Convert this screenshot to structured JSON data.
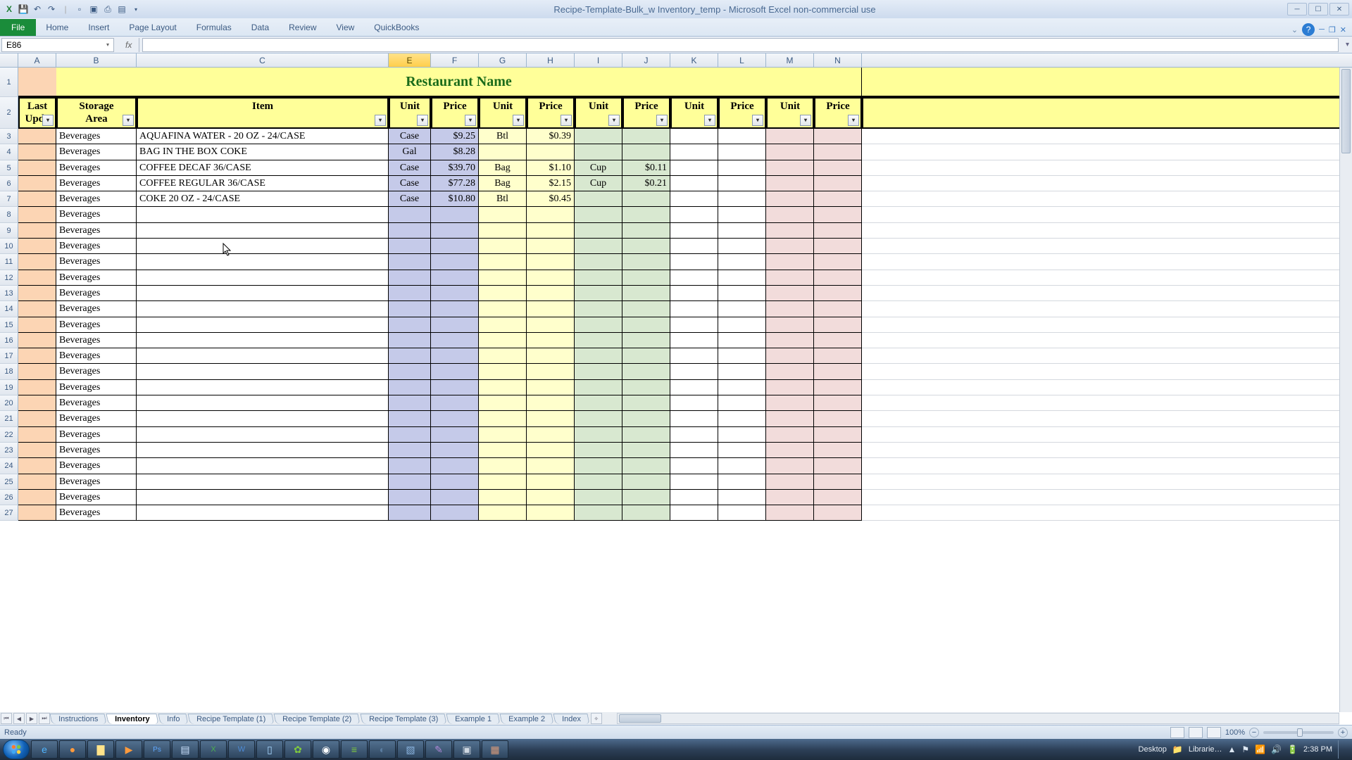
{
  "window": {
    "title": "Recipe-Template-Bulk_w Inventory_temp  -  Microsoft Excel non-commercial use"
  },
  "ribbon": {
    "file": "File",
    "tabs": [
      "Home",
      "Insert",
      "Page Layout",
      "Formulas",
      "Data",
      "Review",
      "View",
      "QuickBooks"
    ]
  },
  "formulabar": {
    "namebox": "E86",
    "formula": ""
  },
  "columns": [
    "A",
    "B",
    "C",
    "E",
    "F",
    "G",
    "H",
    "I",
    "J",
    "K",
    "L",
    "M",
    "N"
  ],
  "selected_column": "E",
  "title_cell": "Restaurant Name",
  "headers": {
    "A": "Last Update",
    "B": "Storage Area",
    "C": "Item",
    "E": "Unit",
    "F": "Price",
    "G": "Unit",
    "H": "Price",
    "I": "Unit",
    "J": "Price",
    "K": "Unit",
    "L": "Price",
    "M": "Unit",
    "N": "Price"
  },
  "rows": [
    {
      "n": 3,
      "B": "Beverages",
      "C": "AQUAFINA WATER - 20 OZ - 24/CASE",
      "E": "Case",
      "F": "$9.25",
      "G": "Btl",
      "H": "$0.39",
      "I": "",
      "J": "",
      "K": "",
      "L": "",
      "M": "",
      "N": ""
    },
    {
      "n": 4,
      "B": "Beverages",
      "C": "BAG IN THE BOX COKE",
      "E": "Gal",
      "F": "$8.28",
      "G": "",
      "H": "",
      "I": "",
      "J": "",
      "K": "",
      "L": "",
      "M": "",
      "N": ""
    },
    {
      "n": 5,
      "B": "Beverages",
      "C": "COFFEE DECAF 36/CASE",
      "E": "Case",
      "F": "$39.70",
      "G": "Bag",
      "H": "$1.10",
      "I": "Cup",
      "J": "$0.11",
      "K": "",
      "L": "",
      "M": "",
      "N": ""
    },
    {
      "n": 6,
      "B": "Beverages",
      "C": "COFFEE REGULAR 36/CASE",
      "E": "Case",
      "F": "$77.28",
      "G": "Bag",
      "H": "$2.15",
      "I": "Cup",
      "J": "$0.21",
      "K": "",
      "L": "",
      "M": "",
      "N": ""
    },
    {
      "n": 7,
      "B": "Beverages",
      "C": "COKE 20 OZ - 24/CASE",
      "E": "Case",
      "F": "$10.80",
      "G": "Btl",
      "H": "$0.45",
      "I": "",
      "J": "",
      "K": "",
      "L": "",
      "M": "",
      "N": ""
    },
    {
      "n": 8,
      "B": "Beverages"
    },
    {
      "n": 9,
      "B": "Beverages"
    },
    {
      "n": 10,
      "B": "Beverages"
    },
    {
      "n": 11,
      "B": "Beverages"
    },
    {
      "n": 12,
      "B": "Beverages"
    },
    {
      "n": 13,
      "B": "Beverages"
    },
    {
      "n": 14,
      "B": "Beverages"
    },
    {
      "n": 15,
      "B": "Beverages"
    },
    {
      "n": 16,
      "B": "Beverages"
    },
    {
      "n": 17,
      "B": "Beverages"
    },
    {
      "n": 18,
      "B": "Beverages"
    },
    {
      "n": 19,
      "B": "Beverages"
    },
    {
      "n": 20,
      "B": "Beverages"
    },
    {
      "n": 21,
      "B": "Beverages"
    },
    {
      "n": 22,
      "B": "Beverages"
    },
    {
      "n": 23,
      "B": "Beverages"
    },
    {
      "n": 24,
      "B": "Beverages"
    },
    {
      "n": 25,
      "B": "Beverages"
    },
    {
      "n": 26,
      "B": "Beverages"
    },
    {
      "n": 27,
      "B": "Beverages"
    }
  ],
  "sheet_tabs": [
    "Instructions",
    "Inventory",
    "Info",
    "Recipe Template (1)",
    "Recipe Template (2)",
    "Recipe Template (3)",
    "Example 1",
    "Example 2",
    "Index"
  ],
  "active_sheet": "Inventory",
  "status": {
    "ready": "Ready",
    "zoom": "100%"
  },
  "taskbar": {
    "desktop": "Desktop",
    "libraries": "Librarie…",
    "time": "2:38 PM"
  }
}
